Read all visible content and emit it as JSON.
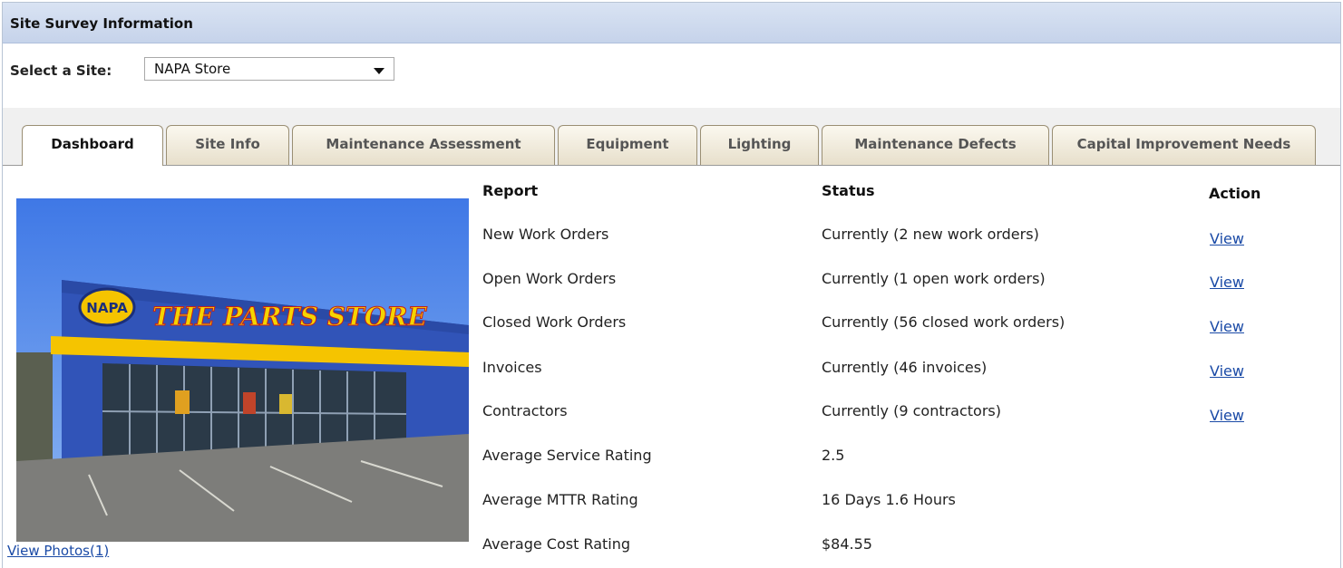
{
  "header": {
    "title": "Site Survey Information"
  },
  "site_select": {
    "label": "Select a Site:",
    "value": "NAPA Store"
  },
  "tabs": [
    {
      "label": "Dashboard",
      "active": true
    },
    {
      "label": "Site Info",
      "active": false
    },
    {
      "label": "Maintenance Assessment",
      "active": false
    },
    {
      "label": "Equipment",
      "active": false
    },
    {
      "label": "Lighting",
      "active": false
    },
    {
      "label": "Maintenance Defects",
      "active": false
    },
    {
      "label": "Capital Improvement Needs",
      "active": false
    }
  ],
  "photo": {
    "sign_logo": "NAPA",
    "sign_text": "THE PARTS STORE",
    "view_photos_label": "View Photos(1)"
  },
  "report": {
    "headers": {
      "report": "Report",
      "status": "Status",
      "action": "Action"
    },
    "rows": [
      {
        "report": "New Work Orders",
        "status": "Currently (2 new work orders)",
        "action": "View"
      },
      {
        "report": "Open Work Orders",
        "status": "Currently (1 open work orders)",
        "action": "View"
      },
      {
        "report": "Closed Work Orders",
        "status": "Currently (56 closed work orders)",
        "action": "View"
      },
      {
        "report": "Invoices",
        "status": "Currently (46 invoices)",
        "action": "View"
      },
      {
        "report": "Contractors",
        "status": "Currently (9 contractors)",
        "action": "View"
      },
      {
        "report": "Average Service Rating",
        "status": "2.5",
        "action": ""
      },
      {
        "report": "Average MTTR Rating",
        "status": "16 Days 1.6 Hours",
        "action": ""
      },
      {
        "report": "Average Cost Rating",
        "status": "$84.55",
        "action": ""
      }
    ]
  },
  "colors": {
    "link": "#1a4aa6",
    "header_bg": "#d9e3f3",
    "tab_bg": "#efe8d6"
  }
}
